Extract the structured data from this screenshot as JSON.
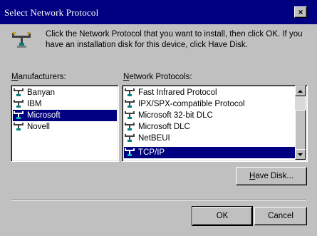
{
  "window": {
    "title": "Select Network Protocol",
    "close_glyph": "×"
  },
  "description": "Click the Network Protocol that you want to install, then click OK. If you have an installation disk for this device, click Have Disk.",
  "manufacturers": {
    "label_mnemonic": "M",
    "label_rest": "anufacturers:",
    "items": [
      {
        "label": "Banyan",
        "icon": "network-protocol-icon",
        "selected": false
      },
      {
        "label": "IBM",
        "icon": "network-protocol-icon",
        "selected": false
      },
      {
        "label": "Microsoft",
        "icon": "network-protocol-icon",
        "selected": true
      },
      {
        "label": "Novell",
        "icon": "network-protocol-icon",
        "selected": false
      }
    ]
  },
  "protocols": {
    "label_mnemonic": "N",
    "label_rest": "etwork Protocols:",
    "items": [
      {
        "label": "Fast Infrared Protocol",
        "icon": "network-protocol-icon",
        "selected": false
      },
      {
        "label": "IPX/SPX-compatible Protocol",
        "icon": "network-protocol-icon",
        "selected": false
      },
      {
        "label": "Microsoft 32-bit DLC",
        "icon": "network-protocol-icon",
        "selected": false
      },
      {
        "label": "Microsoft DLC",
        "icon": "network-protocol-icon",
        "selected": false
      },
      {
        "label": "NetBEUI",
        "icon": "network-protocol-icon",
        "selected": false
      },
      {
        "label": "TCP/IP",
        "icon": "network-protocol-icon",
        "selected": true
      }
    ]
  },
  "buttons": {
    "have_disk_mnemonic": "H",
    "have_disk_rest": "ave Disk...",
    "ok": "OK",
    "cancel": "Cancel"
  },
  "colors": {
    "title_bar": "#000080",
    "face": "#c0c0c0",
    "selection": "#000080"
  }
}
